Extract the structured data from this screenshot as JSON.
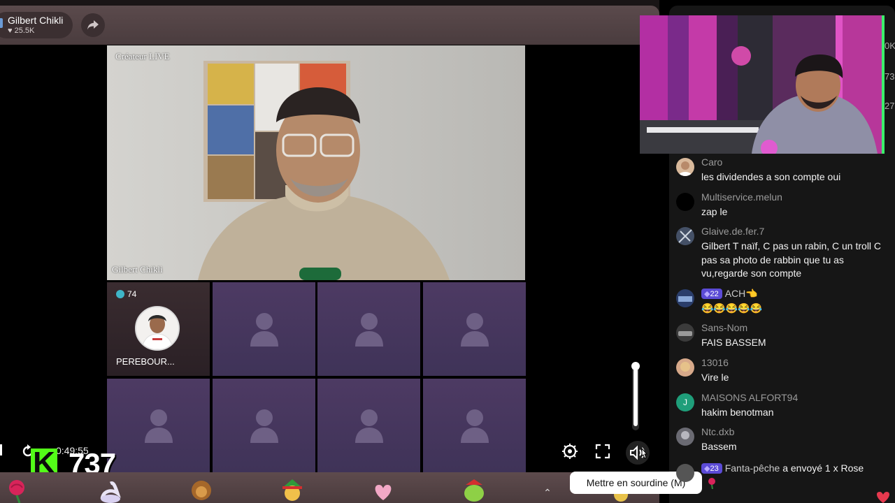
{
  "host": {
    "name": "Gilbert Chikli",
    "likes": "25.5K"
  },
  "stage": {
    "creator_label": "Créateur LIVE",
    "host_video_name": "Gilbert Chikli",
    "guest": {
      "name": "PEREBOUR...",
      "level": "74"
    },
    "empty_seats": 7
  },
  "overlay": {
    "timer": "0:49:55",
    "viewers": "737",
    "kick_letter": "K"
  },
  "controls": {
    "mute_tooltip": "Mettre en sourdine (M)",
    "volume_level": 0.95
  },
  "edge_numbers": [
    "0K",
    "73",
    "27"
  ],
  "chat": [
    {
      "user": "Caro",
      "text": "les dividendes a son compte oui",
      "avatar": "photo"
    },
    {
      "user": "Multiservice.melun",
      "text": "zap le",
      "avatar": "black"
    },
    {
      "user": "Glaive.de.fer.7",
      "text": "Gilbert T naïf, C pas un rabin, C un troll C pas sa photo de rabbin que tu as vu,regarde son compte",
      "avatar": "photo"
    },
    {
      "user": "ACH👈",
      "badge": "22",
      "text": "😂😂😂😂😂",
      "avatar": "photo"
    },
    {
      "user": "Sans-Nom",
      "text": "FAIS BASSEM",
      "avatar": "photo"
    },
    {
      "user": "13016",
      "text": "Vire le",
      "avatar": "photo"
    },
    {
      "user": "MAISONS ALFORT94",
      "text": "hakim benotman",
      "avatar": "letter",
      "letter": "J",
      "avatar_color": "#1f9e7a"
    },
    {
      "user": "Ntc.dxb",
      "text": "Bassem",
      "avatar": "photo"
    },
    {
      "user": "Fanta-pêche",
      "badge": "23",
      "action": "a envoyé 1 x Rose",
      "avatar": "photo"
    }
  ],
  "colors": {
    "kick_green": "#53fc18",
    "seat_purple": "#4d3a63",
    "badge_purple": "#5b4bd6"
  }
}
